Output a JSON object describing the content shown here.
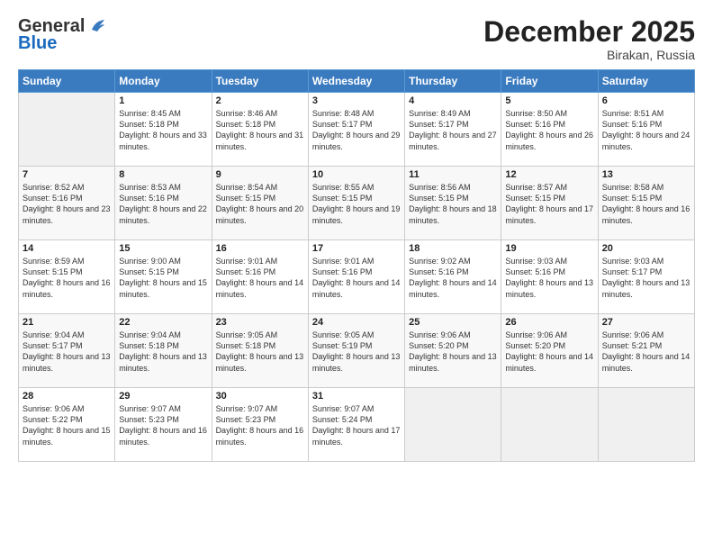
{
  "header": {
    "logo_line1": "General",
    "logo_line2": "Blue",
    "month": "December 2025",
    "location": "Birakan, Russia"
  },
  "weekdays": [
    "Sunday",
    "Monday",
    "Tuesday",
    "Wednesday",
    "Thursday",
    "Friday",
    "Saturday"
  ],
  "weeks": [
    [
      {
        "day": "",
        "sunrise": "",
        "sunset": "",
        "daylight": ""
      },
      {
        "day": "1",
        "sunrise": "Sunrise: 8:45 AM",
        "sunset": "Sunset: 5:18 PM",
        "daylight": "Daylight: 8 hours and 33 minutes."
      },
      {
        "day": "2",
        "sunrise": "Sunrise: 8:46 AM",
        "sunset": "Sunset: 5:18 PM",
        "daylight": "Daylight: 8 hours and 31 minutes."
      },
      {
        "day": "3",
        "sunrise": "Sunrise: 8:48 AM",
        "sunset": "Sunset: 5:17 PM",
        "daylight": "Daylight: 8 hours and 29 minutes."
      },
      {
        "day": "4",
        "sunrise": "Sunrise: 8:49 AM",
        "sunset": "Sunset: 5:17 PM",
        "daylight": "Daylight: 8 hours and 27 minutes."
      },
      {
        "day": "5",
        "sunrise": "Sunrise: 8:50 AM",
        "sunset": "Sunset: 5:16 PM",
        "daylight": "Daylight: 8 hours and 26 minutes."
      },
      {
        "day": "6",
        "sunrise": "Sunrise: 8:51 AM",
        "sunset": "Sunset: 5:16 PM",
        "daylight": "Daylight: 8 hours and 24 minutes."
      }
    ],
    [
      {
        "day": "7",
        "sunrise": "Sunrise: 8:52 AM",
        "sunset": "Sunset: 5:16 PM",
        "daylight": "Daylight: 8 hours and 23 minutes."
      },
      {
        "day": "8",
        "sunrise": "Sunrise: 8:53 AM",
        "sunset": "Sunset: 5:16 PM",
        "daylight": "Daylight: 8 hours and 22 minutes."
      },
      {
        "day": "9",
        "sunrise": "Sunrise: 8:54 AM",
        "sunset": "Sunset: 5:15 PM",
        "daylight": "Daylight: 8 hours and 20 minutes."
      },
      {
        "day": "10",
        "sunrise": "Sunrise: 8:55 AM",
        "sunset": "Sunset: 5:15 PM",
        "daylight": "Daylight: 8 hours and 19 minutes."
      },
      {
        "day": "11",
        "sunrise": "Sunrise: 8:56 AM",
        "sunset": "Sunset: 5:15 PM",
        "daylight": "Daylight: 8 hours and 18 minutes."
      },
      {
        "day": "12",
        "sunrise": "Sunrise: 8:57 AM",
        "sunset": "Sunset: 5:15 PM",
        "daylight": "Daylight: 8 hours and 17 minutes."
      },
      {
        "day": "13",
        "sunrise": "Sunrise: 8:58 AM",
        "sunset": "Sunset: 5:15 PM",
        "daylight": "Daylight: 8 hours and 16 minutes."
      }
    ],
    [
      {
        "day": "14",
        "sunrise": "Sunrise: 8:59 AM",
        "sunset": "Sunset: 5:15 PM",
        "daylight": "Daylight: 8 hours and 16 minutes."
      },
      {
        "day": "15",
        "sunrise": "Sunrise: 9:00 AM",
        "sunset": "Sunset: 5:15 PM",
        "daylight": "Daylight: 8 hours and 15 minutes."
      },
      {
        "day": "16",
        "sunrise": "Sunrise: 9:01 AM",
        "sunset": "Sunset: 5:16 PM",
        "daylight": "Daylight: 8 hours and 14 minutes."
      },
      {
        "day": "17",
        "sunrise": "Sunrise: 9:01 AM",
        "sunset": "Sunset: 5:16 PM",
        "daylight": "Daylight: 8 hours and 14 minutes."
      },
      {
        "day": "18",
        "sunrise": "Sunrise: 9:02 AM",
        "sunset": "Sunset: 5:16 PM",
        "daylight": "Daylight: 8 hours and 14 minutes."
      },
      {
        "day": "19",
        "sunrise": "Sunrise: 9:03 AM",
        "sunset": "Sunset: 5:16 PM",
        "daylight": "Daylight: 8 hours and 13 minutes."
      },
      {
        "day": "20",
        "sunrise": "Sunrise: 9:03 AM",
        "sunset": "Sunset: 5:17 PM",
        "daylight": "Daylight: 8 hours and 13 minutes."
      }
    ],
    [
      {
        "day": "21",
        "sunrise": "Sunrise: 9:04 AM",
        "sunset": "Sunset: 5:17 PM",
        "daylight": "Daylight: 8 hours and 13 minutes."
      },
      {
        "day": "22",
        "sunrise": "Sunrise: 9:04 AM",
        "sunset": "Sunset: 5:18 PM",
        "daylight": "Daylight: 8 hours and 13 minutes."
      },
      {
        "day": "23",
        "sunrise": "Sunrise: 9:05 AM",
        "sunset": "Sunset: 5:18 PM",
        "daylight": "Daylight: 8 hours and 13 minutes."
      },
      {
        "day": "24",
        "sunrise": "Sunrise: 9:05 AM",
        "sunset": "Sunset: 5:19 PM",
        "daylight": "Daylight: 8 hours and 13 minutes."
      },
      {
        "day": "25",
        "sunrise": "Sunrise: 9:06 AM",
        "sunset": "Sunset: 5:20 PM",
        "daylight": "Daylight: 8 hours and 13 minutes."
      },
      {
        "day": "26",
        "sunrise": "Sunrise: 9:06 AM",
        "sunset": "Sunset: 5:20 PM",
        "daylight": "Daylight: 8 hours and 14 minutes."
      },
      {
        "day": "27",
        "sunrise": "Sunrise: 9:06 AM",
        "sunset": "Sunset: 5:21 PM",
        "daylight": "Daylight: 8 hours and 14 minutes."
      }
    ],
    [
      {
        "day": "28",
        "sunrise": "Sunrise: 9:06 AM",
        "sunset": "Sunset: 5:22 PM",
        "daylight": "Daylight: 8 hours and 15 minutes."
      },
      {
        "day": "29",
        "sunrise": "Sunrise: 9:07 AM",
        "sunset": "Sunset: 5:23 PM",
        "daylight": "Daylight: 8 hours and 16 minutes."
      },
      {
        "day": "30",
        "sunrise": "Sunrise: 9:07 AM",
        "sunset": "Sunset: 5:23 PM",
        "daylight": "Daylight: 8 hours and 16 minutes."
      },
      {
        "day": "31",
        "sunrise": "Sunrise: 9:07 AM",
        "sunset": "Sunset: 5:24 PM",
        "daylight": "Daylight: 8 hours and 17 minutes."
      },
      {
        "day": "",
        "sunrise": "",
        "sunset": "",
        "daylight": ""
      },
      {
        "day": "",
        "sunrise": "",
        "sunset": "",
        "daylight": ""
      },
      {
        "day": "",
        "sunrise": "",
        "sunset": "",
        "daylight": ""
      }
    ]
  ]
}
